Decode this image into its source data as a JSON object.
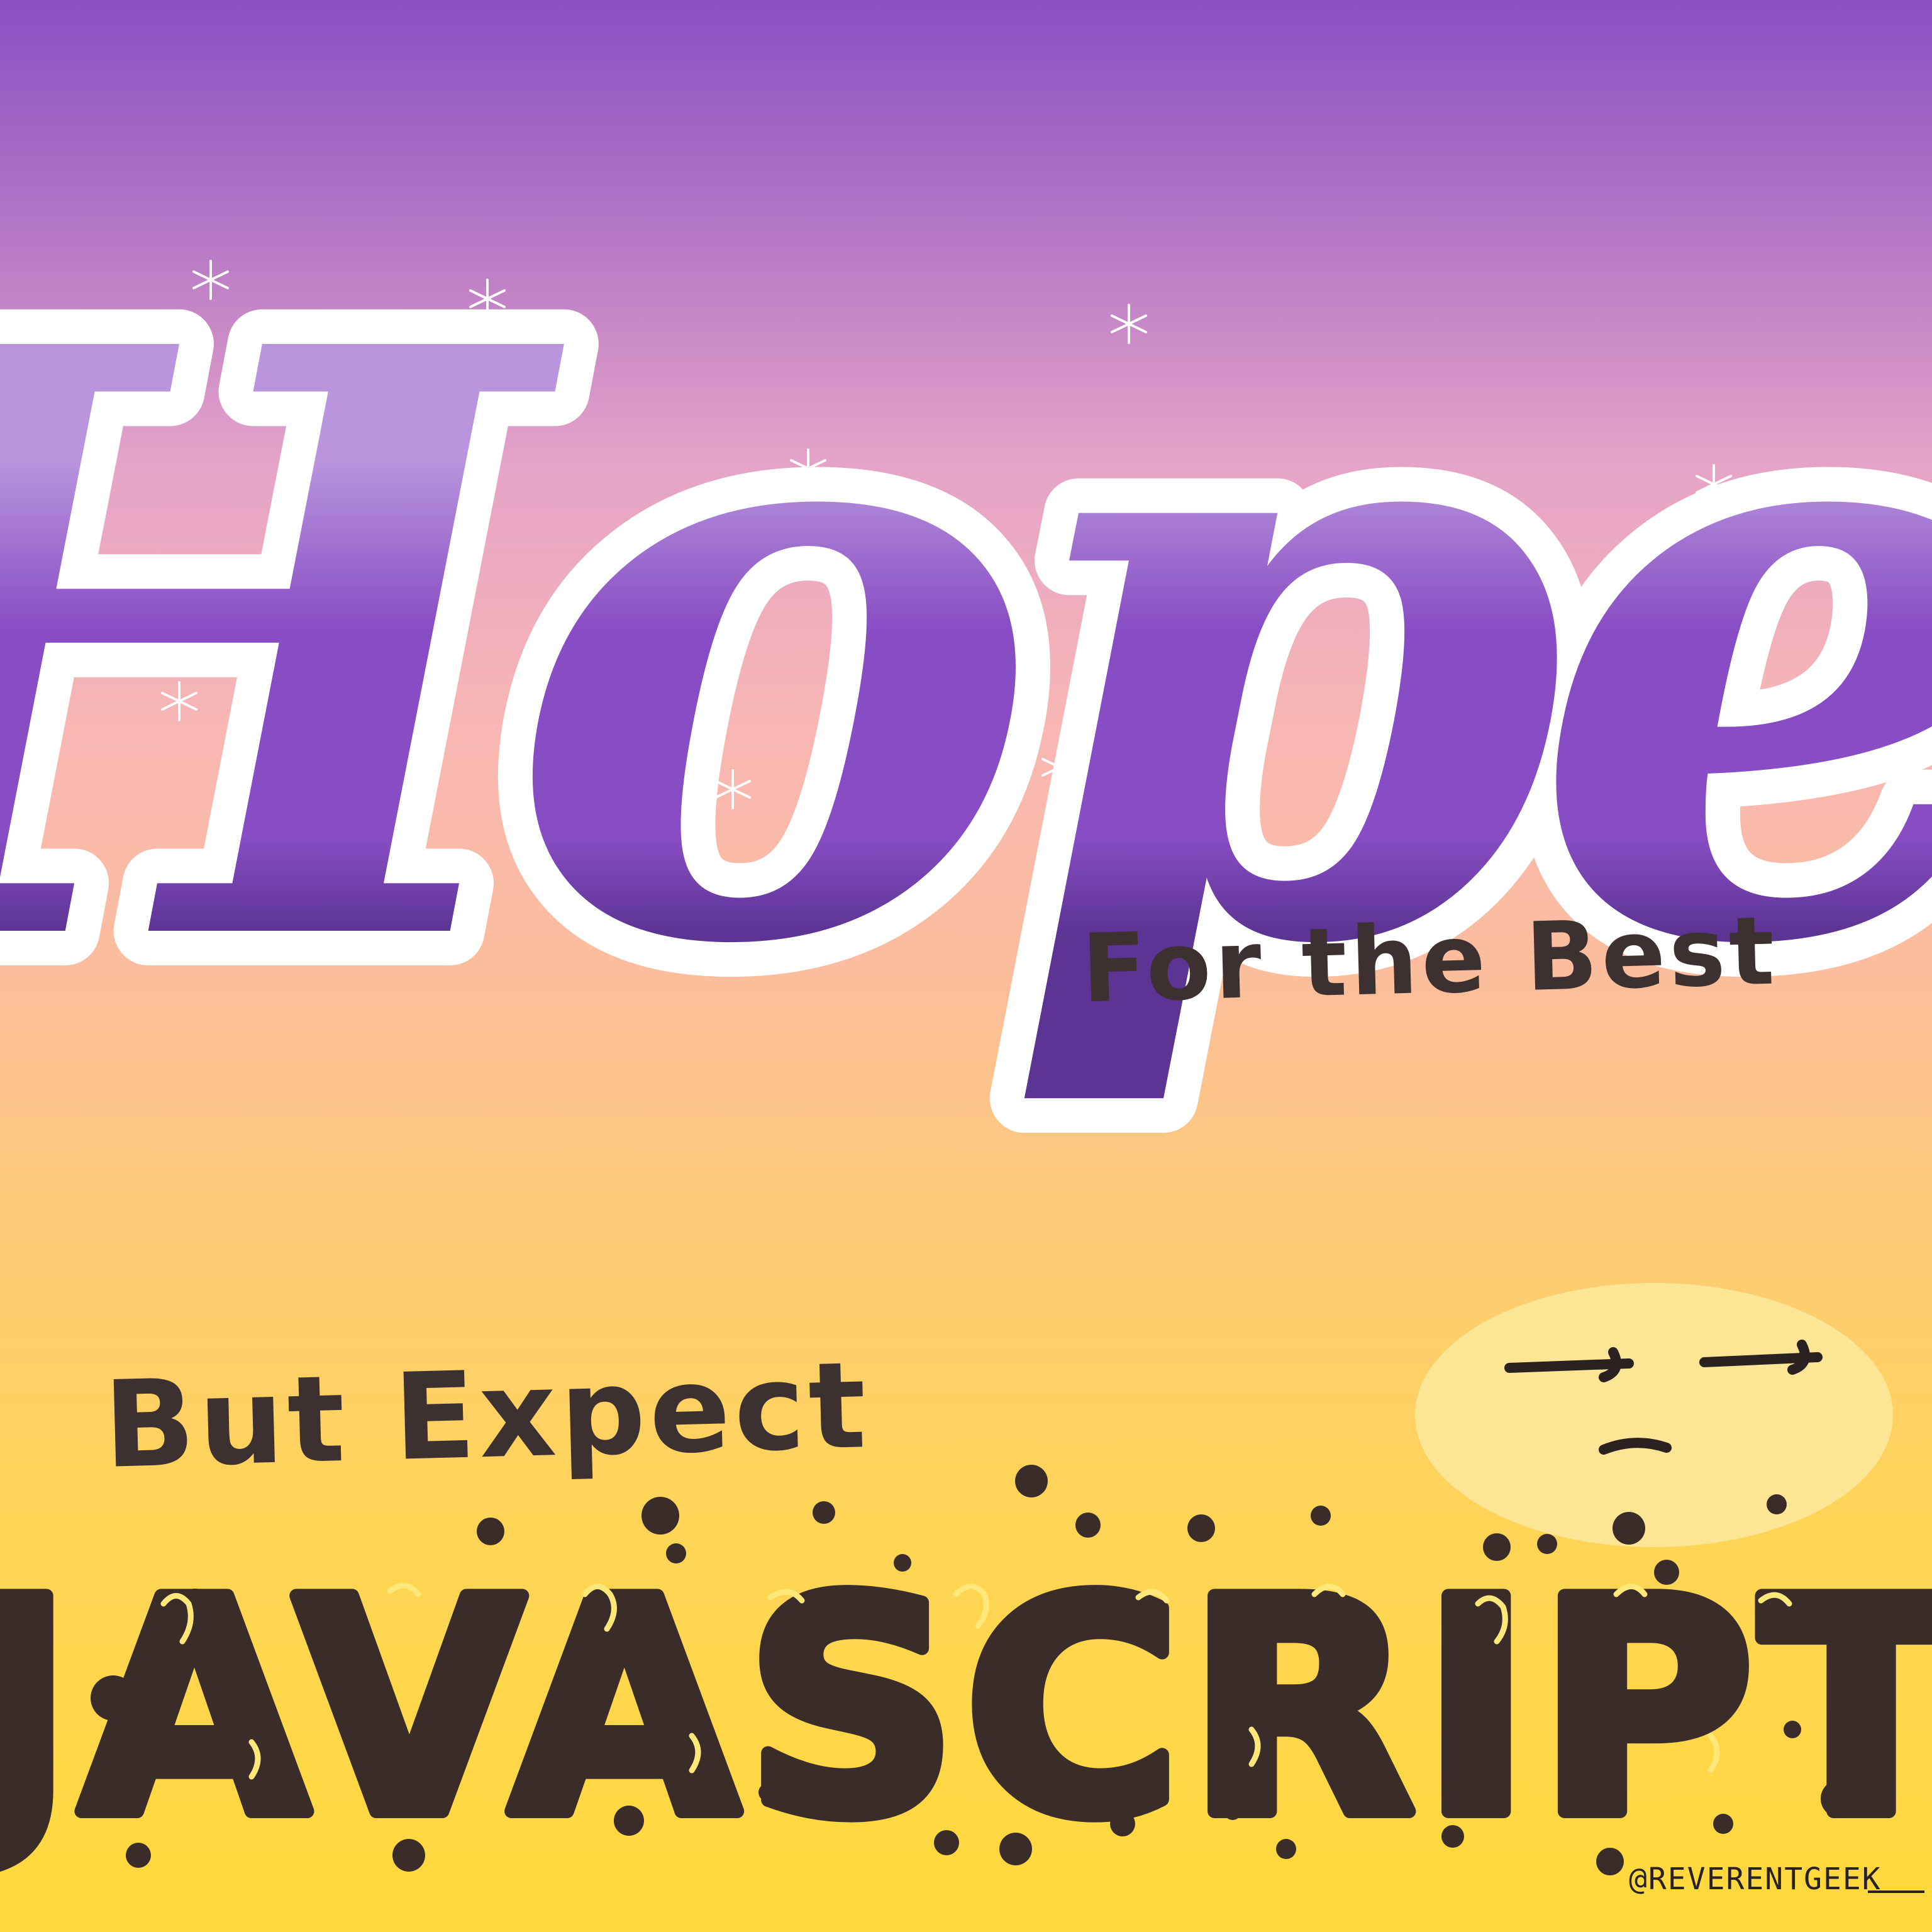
{
  "headline": {
    "main_word": "Hope",
    "tagline": "For the Best"
  },
  "subline": {
    "lead": "But Expect",
    "word": "JAVASCRIPT"
  },
  "credit": {
    "handle": "@REVERENTGEEK"
  },
  "colors": {
    "purple_light": "#b995dd",
    "purple_mid": "#884dc4",
    "purple_dark": "#5c3494",
    "outline_white": "#ffffff",
    "text_dark": "#3d3030",
    "goo_dark": "#3a2c28",
    "bubble_yellow": "#fde596"
  },
  "decorations": {
    "sparkle_icon": "sparkle-icon",
    "face_icon": "unamused-face-icon"
  }
}
